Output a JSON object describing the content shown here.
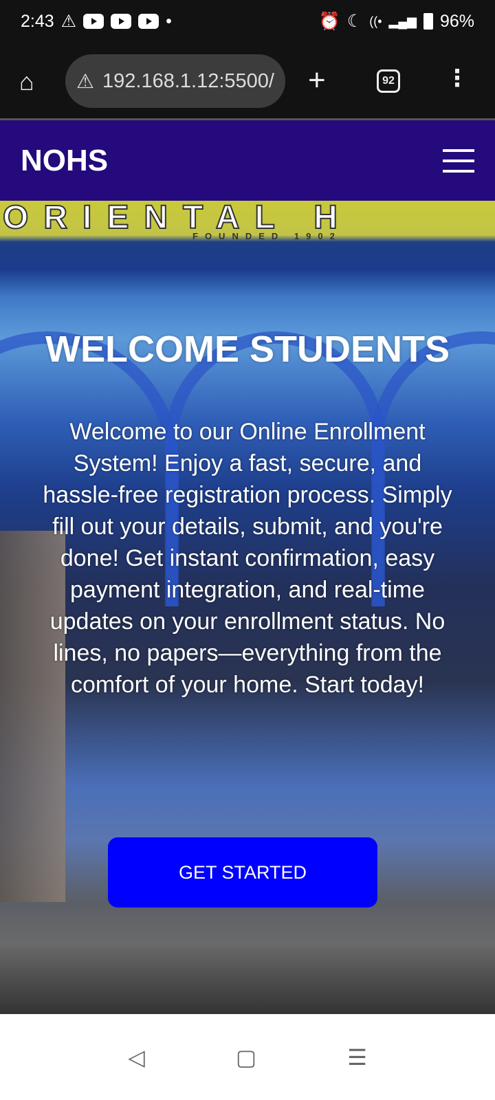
{
  "status_bar": {
    "time": "2:43",
    "battery": "96%",
    "icons": [
      "warning-icon",
      "youtube-icon",
      "youtube-icon",
      "youtube-icon",
      "dot-icon",
      "alarm-icon",
      "moon-icon",
      "wifi-icon",
      "signal-icon",
      "battery-icon"
    ]
  },
  "browser": {
    "url": "192.168.1.12:5500/",
    "tab_count": "92"
  },
  "navbar": {
    "brand": "NOHS"
  },
  "hero": {
    "sign_text": "ORIENTAL H",
    "sign_subtext": "FOUNDED 1902",
    "title": "WELCOME STUDENTS",
    "description": "Welcome to our Online Enrollment System! Enjoy a fast, secure, and hassle-free registration process. Simply fill out your details, submit, and you're done! Get instant confirmation, easy payment integration, and real-time updates on your enrollment status. No lines, no papers—everything from the comfort of your home. Start today!",
    "cta_label": "GET STARTED"
  },
  "colors": {
    "navbar": "#240a7c",
    "cta": "#0000ff"
  }
}
